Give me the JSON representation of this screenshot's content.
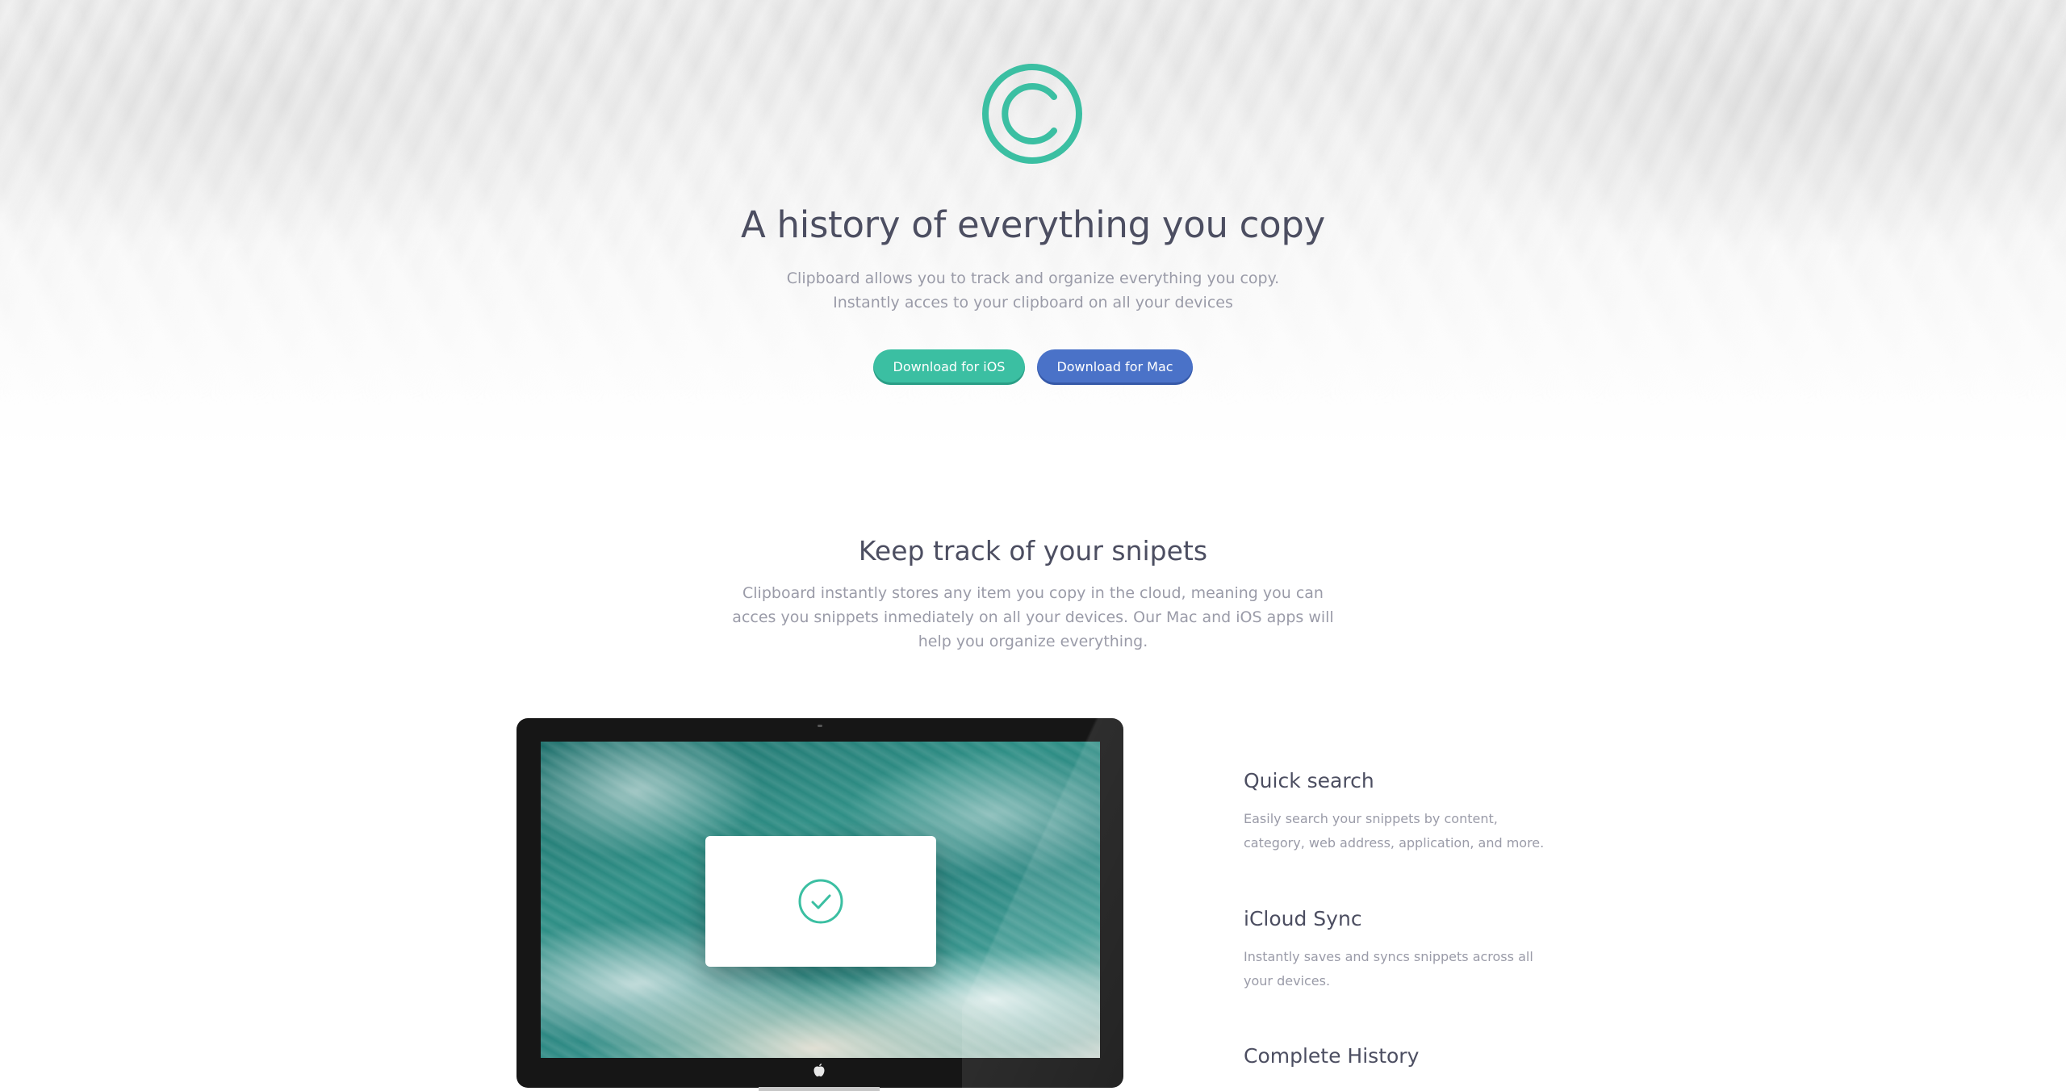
{
  "hero": {
    "title": "A history of everything you copy",
    "text": "Clipboard allows you to track and organize everything you copy. Instantly acces to your clipboard on all your devices",
    "buttons": {
      "ios_label": "Download for iOS",
      "mac_label": "Download for Mac"
    },
    "logo_icon": "copyright-circle-icon"
  },
  "snippets": {
    "title": "Keep track of your snipets",
    "text": "Clipboard instantly stores any item you copy in the cloud, meaning you can acces you snippets inmediately on all your devices. Our Mac and iOS apps will help you organize everything."
  },
  "features": [
    {
      "title": "Quick search",
      "text": "Easily search your snippets by content, category, web address, application, and more."
    },
    {
      "title": "iCloud Sync",
      "text": "Instantly saves and syncs snippets across all your devices."
    },
    {
      "title": "Complete History",
      "text": ""
    }
  ],
  "colors": {
    "accent_green": "#3bbfa2",
    "accent_blue": "#4a72c8",
    "heading": "#4c4e61",
    "body_text": "#9a9ba8"
  },
  "icons": {
    "check": "check-circle-icon",
    "apple": "apple-logo-icon"
  }
}
